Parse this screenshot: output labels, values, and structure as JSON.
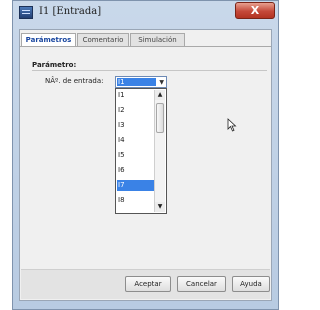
{
  "window": {
    "title": "I1 [Entrada]",
    "close_label": "X",
    "app_icon": "app-icon"
  },
  "tabs": [
    "Parámetros",
    "Comentario",
    "Simulación"
  ],
  "active_tab": 0,
  "parameters": {
    "group_title": "Parámetro:",
    "field_label": "NÂº. de entrada:",
    "selected_value": "I1",
    "options": [
      "I1",
      "I2",
      "I3",
      "I4",
      "I5",
      "I6",
      "I7",
      "I8"
    ],
    "highlighted_option": "I7"
  },
  "buttons": {
    "accept": "Aceptar",
    "cancel": "Cancelar",
    "help": "Ayuda"
  },
  "colors": {
    "selection": "#3a82e6",
    "close_button": "#c5493a",
    "active_tab_text": "#1a47a0"
  }
}
